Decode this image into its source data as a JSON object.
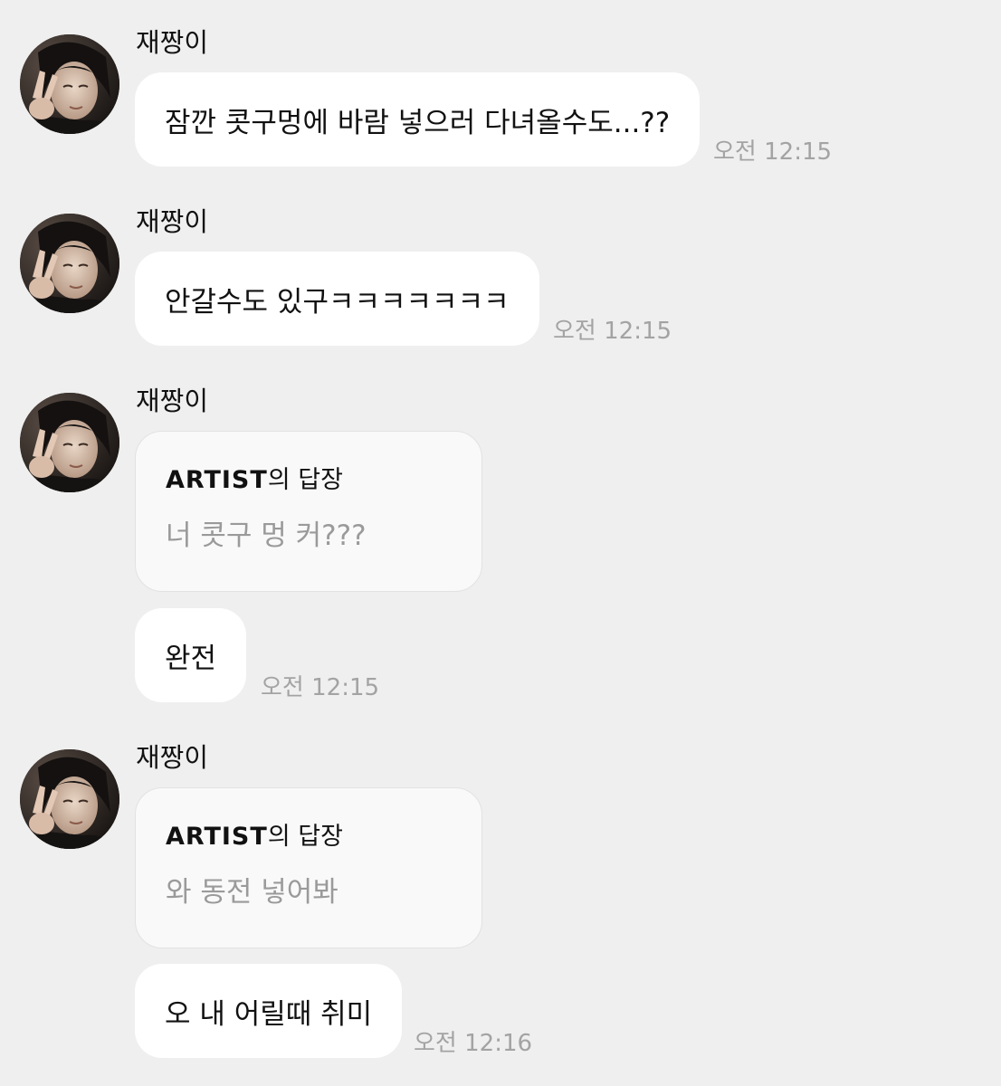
{
  "colors": {
    "background": "#efefef",
    "bubble": "#ffffff",
    "reply_card": "#f9f9f9",
    "reply_text": "#9a9a9a",
    "timestamp": "#a3a3a3"
  },
  "messages": [
    {
      "sender": "재짱이",
      "text": "잠깐 콧구멍에 바람 넣으러 다녀올수도...??",
      "time": "오전 12:15"
    },
    {
      "sender": "재짱이",
      "text": "안갈수도 있구ㅋㅋㅋㅋㅋㅋㅋ",
      "time": "오전 12:15"
    },
    {
      "sender": "재짱이",
      "reply": {
        "artist": "ARTIST",
        "suffix": "의 답장",
        "text": "너 콧구 멍 커???"
      },
      "text": "완전",
      "time": "오전 12:15"
    },
    {
      "sender": "재짱이",
      "reply": {
        "artist": "ARTIST",
        "suffix": "의 답장",
        "text": "와 동전 넣어봐"
      },
      "text": "오 내 어릴때 취미",
      "time": "오전 12:16"
    }
  ]
}
